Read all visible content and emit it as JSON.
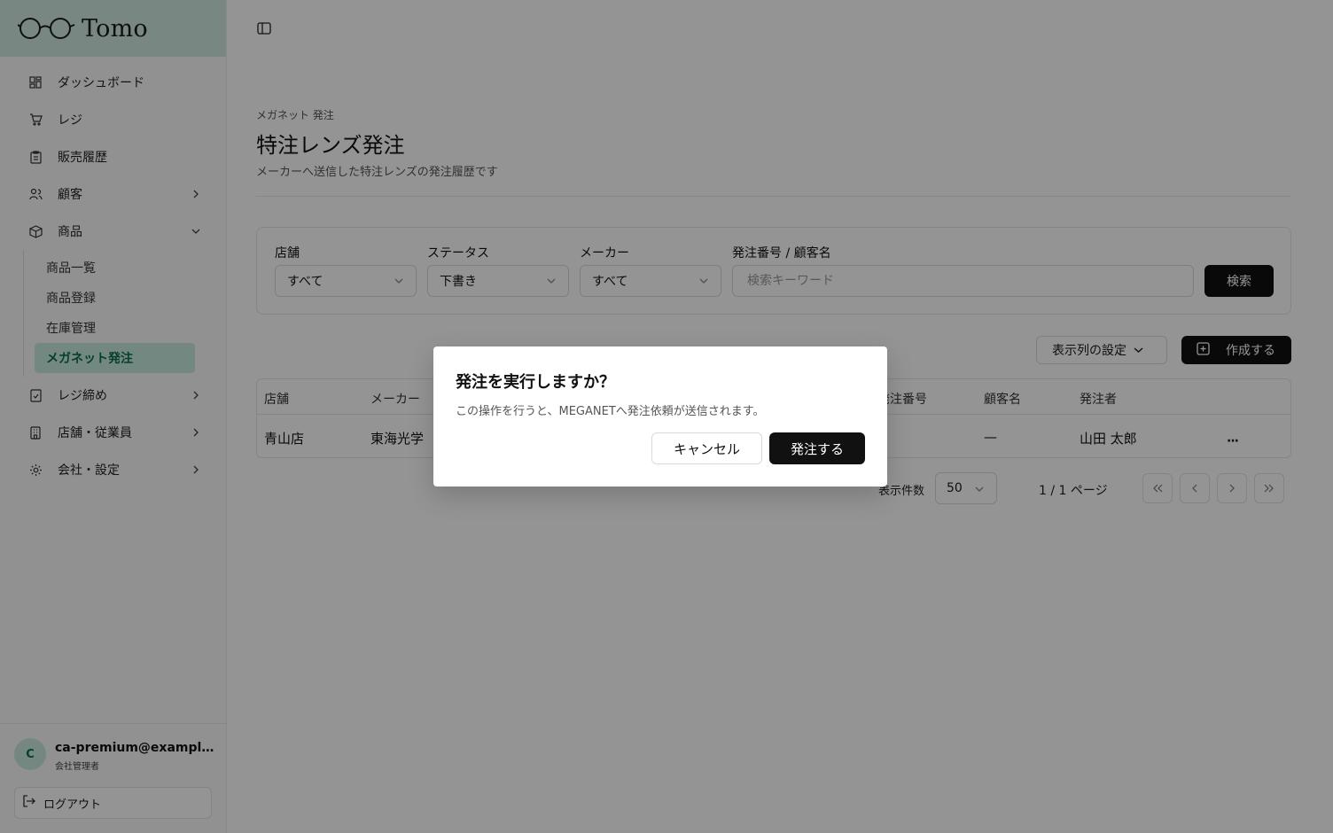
{
  "sidebar": {
    "logo_text": "Tomo",
    "items": [
      {
        "label": "ダッシュボード",
        "icon": "dashboard-icon"
      },
      {
        "label": "レジ",
        "icon": "cart-icon"
      },
      {
        "label": "販売履歴",
        "icon": "clipboard-icon"
      },
      {
        "label": "顧客",
        "icon": "users-icon"
      },
      {
        "label": "商品",
        "icon": "package-icon"
      }
    ],
    "product_sub": [
      "商品一覧",
      "商品登録",
      "在庫管理",
      "メガネット発注"
    ],
    "items_after": [
      {
        "label": "レジ締め",
        "icon": "register-close-icon"
      },
      {
        "label": "店舗・従業員",
        "icon": "store-icon"
      },
      {
        "label": "会社・設定",
        "icon": "settings-icon"
      }
    ],
    "user": {
      "avatar_initial": "C",
      "email": "ca-premium@example.com",
      "role": "会社管理者"
    },
    "logout_label": "ログアウト"
  },
  "page": {
    "breadcrumb": "メガネット 発注",
    "title": "特注レンズ発注",
    "description": "メーカーへ送信した特注レンズの発注履歴です"
  },
  "filters": {
    "store": {
      "label": "店舗",
      "value": "すべて"
    },
    "status": {
      "label": "ステータス",
      "value": "下書き"
    },
    "maker": {
      "label": "メーカー",
      "value": "すべて"
    },
    "keyword": {
      "label": "発注番号 / 顧客名",
      "placeholder": "検索キーワード",
      "value": ""
    },
    "search_label": "検索"
  },
  "toolbar": {
    "columns_label": "表示列の設定",
    "create_label": "作成する"
  },
  "table": {
    "headers": [
      "店舗",
      "メーカー",
      "発注番号",
      "顧客名",
      "発注者"
    ],
    "rows": [
      {
        "store": "青山店",
        "maker": "東海光学",
        "customer": "—",
        "orderer": "山田 太郎",
        "menu": "···"
      }
    ]
  },
  "pagination": {
    "per_page_label": "表示件数",
    "per_page": "50",
    "page_info": "1 / 1 ページ"
  },
  "dialog": {
    "title": "発注を実行しますか？",
    "message": "この操作を行うと、MEGANETへ発注依頼が送信されます。",
    "cancel_label": "キャンセル",
    "confirm_label": "発注する"
  }
}
